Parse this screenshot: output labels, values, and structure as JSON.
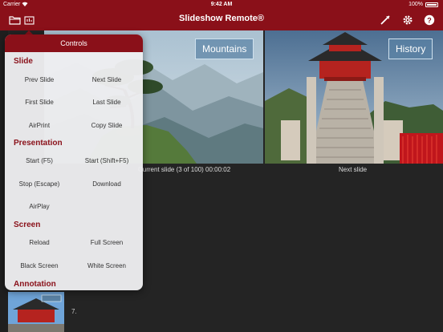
{
  "status": {
    "carrier": "Carrier",
    "time": "9:42 AM",
    "battery": "100%"
  },
  "nav": {
    "title": "Slideshow Remote®",
    "icons": [
      "folder-icon",
      "slides-icon",
      "pointer-icon",
      "gear-icon",
      "help-icon"
    ]
  },
  "slides": {
    "current": {
      "label": "Mountains",
      "caption": "Current slide (3 of 100) 00:00:02"
    },
    "next": {
      "label": "History",
      "caption": "Next slide"
    },
    "bottom_index": "7."
  },
  "controls": {
    "title": "Controls",
    "slide": {
      "header": "Slide",
      "prev": "Prev Slide",
      "next": "Next Slide",
      "first": "First Slide",
      "last": "Last Slide",
      "airprint": "AirPrint",
      "copy": "Copy Slide"
    },
    "presentation": {
      "header": "Presentation",
      "start": "Start (F5)",
      "start_shift": "Start (Shift+F5)",
      "stop": "Stop (Escape)",
      "download": "Download",
      "airplay": "AirPlay"
    },
    "screen": {
      "header": "Screen",
      "reload": "Reload",
      "full": "Full Screen",
      "black": "Black Screen",
      "white": "White Screen"
    },
    "annotation": {
      "header": "Annotation"
    }
  },
  "colors": {
    "brand": "#8a1019",
    "slide_label_bg": "#5a82a5"
  }
}
